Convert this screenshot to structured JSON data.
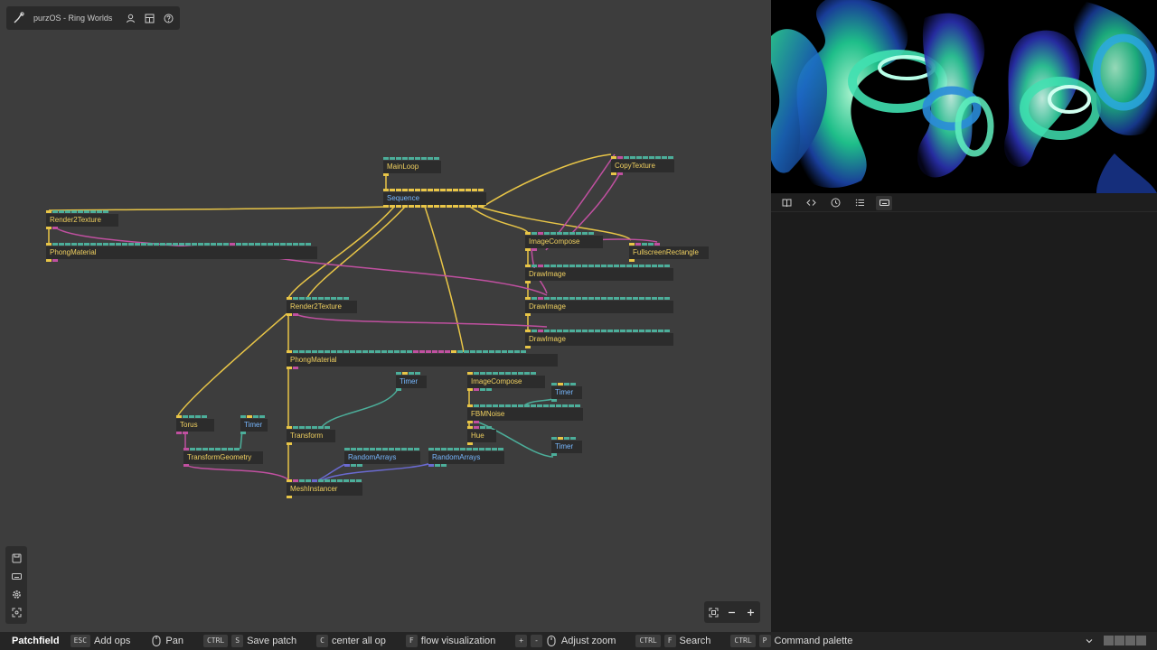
{
  "app": {
    "title": "purzOS - Ring Worlds"
  },
  "ops": {
    "mainloop": "MainLoop",
    "sequence": "Sequence",
    "copytexture": "CopyTexture",
    "render2texture_a": "Render2Texture",
    "phongmaterial_a": "PhongMaterial",
    "imagecompose_a": "ImageCompose",
    "fullscreenrect": "FullscreenRectangle",
    "drawimage_1": "DrawImage",
    "drawimage_2": "DrawImage",
    "drawimage_3": "DrawImage",
    "render2texture_b": "Render2Texture",
    "phongmaterial_b": "PhongMaterial",
    "timer_1": "Timer",
    "imagecompose_b": "ImageCompose",
    "timer_2": "Timer",
    "fbmnoise": "FBMNoise",
    "hue": "Hue",
    "timer_3": "Timer",
    "torus": "Torus",
    "timer_4": "Timer",
    "transform": "Transform",
    "transformgeometry": "TransformGeometry",
    "randomarrays_1": "RandomArrays",
    "randomarrays_2": "RandomArrays",
    "meshinstancer": "MeshInstancer"
  },
  "status_bar": {
    "brand": "Patchfield",
    "hints": [
      {
        "keys": [
          "ESC"
        ],
        "label": "Add ops"
      },
      {
        "keys": [],
        "label": "Pan"
      },
      {
        "keys": [
          "CTRL",
          "S"
        ],
        "label": "Save patch"
      },
      {
        "keys": [
          "C"
        ],
        "label": "center all op"
      },
      {
        "keys": [
          "F"
        ],
        "label": "flow visualization"
      },
      {
        "keys": [
          "+",
          "-"
        ],
        "label": "Adjust zoom"
      },
      {
        "keys": [
          "CTRL",
          "F"
        ],
        "label": "Search"
      },
      {
        "keys": [
          "CTRL",
          "P"
        ],
        "label": "Command palette"
      }
    ]
  },
  "icons": {
    "title_bar": [
      "patch-logo-icon",
      "user-icon",
      "grid-icon",
      "help-icon"
    ],
    "left_tools": [
      "save-icon",
      "keyboard-icon",
      "settings-icon",
      "fit-view-icon"
    ],
    "zoom": [
      "fit-screen-icon",
      "zoom-out-icon",
      "zoom-in-icon"
    ],
    "panel_tabs": [
      "book-icon",
      "code-icon",
      "history-icon",
      "list-icon",
      "keyboard-icon"
    ],
    "status": [
      "mouse-icon",
      "chevron-down-icon"
    ]
  },
  "colors": {
    "wire_yellow": "#e8c547",
    "wire_pink": "#c050a0",
    "wire_green": "#4cae9a",
    "wire_blue": "#6a6ad0",
    "timer_text": "#78b8ff",
    "op_text": "#f0d060"
  }
}
